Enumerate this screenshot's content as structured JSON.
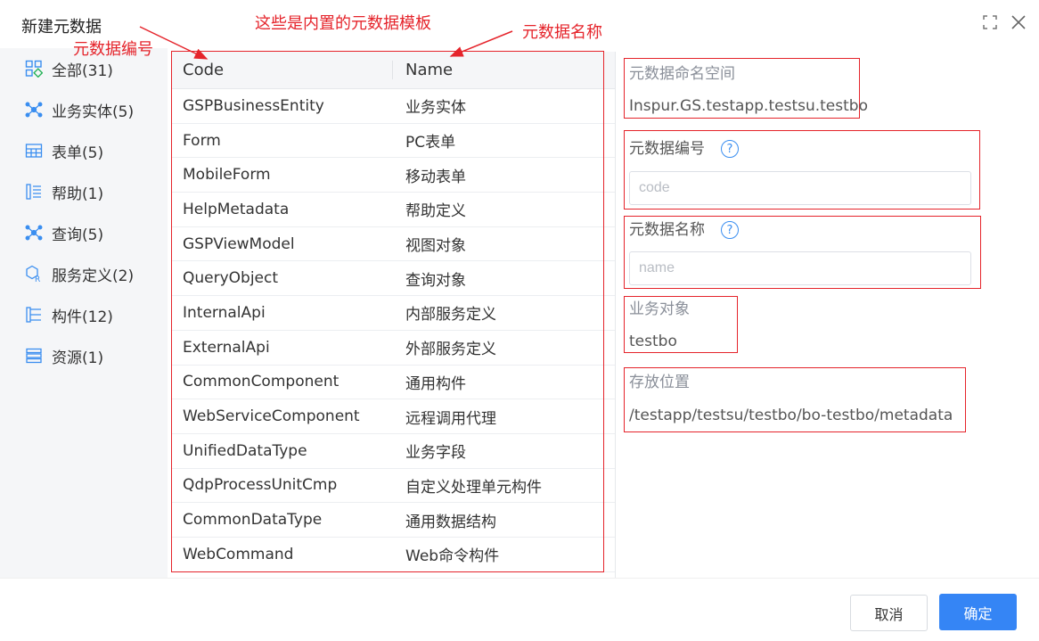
{
  "dialog": {
    "title": "新建元数据"
  },
  "annotations": {
    "builtin_templates": "这些是内置的元数据模板",
    "metadata_code": "元数据编号",
    "metadata_name": "元数据名称"
  },
  "sidebar": {
    "items": [
      {
        "label": "全部(31)",
        "icon": "grid-icon"
      },
      {
        "label": "业务实体(5)",
        "icon": "entity-icon"
      },
      {
        "label": "表单(5)",
        "icon": "table-icon"
      },
      {
        "label": "帮助(1)",
        "icon": "help-list-icon"
      },
      {
        "label": "查询(5)",
        "icon": "query-icon"
      },
      {
        "label": "服务定义(2)",
        "icon": "service-icon"
      },
      {
        "label": "构件(12)",
        "icon": "component-icon"
      },
      {
        "label": "资源(1)",
        "icon": "resource-icon"
      }
    ]
  },
  "table": {
    "headers": {
      "code": "Code",
      "name": "Name"
    },
    "rows": [
      {
        "code": "GSPBusinessEntity",
        "name": "业务实体"
      },
      {
        "code": "Form",
        "name": "PC表单"
      },
      {
        "code": "MobileForm",
        "name": "移动表单"
      },
      {
        "code": "HelpMetadata",
        "name": "帮助定义"
      },
      {
        "code": "GSPViewModel",
        "name": "视图对象"
      },
      {
        "code": "QueryObject",
        "name": "查询对象"
      },
      {
        "code": "InternalApi",
        "name": "内部服务定义"
      },
      {
        "code": "ExternalApi",
        "name": "外部服务定义"
      },
      {
        "code": "CommonComponent",
        "name": "通用构件"
      },
      {
        "code": "WebServiceComponent",
        "name": "远程调用代理"
      },
      {
        "code": "UnifiedDataType",
        "name": "业务字段"
      },
      {
        "code": "QdpProcessUnitCmp",
        "name": "自定义处理单元构件"
      },
      {
        "code": "CommonDataType",
        "name": "通用数据结构"
      },
      {
        "code": "WebCommand",
        "name": "Web命令构件"
      }
    ]
  },
  "form": {
    "namespace_label": "元数据命名空间",
    "namespace_value": "Inspur.GS.testapp.testsu.testbo",
    "code_label": "元数据编号",
    "code_placeholder": "code",
    "name_label": "元数据名称",
    "name_placeholder": "name",
    "bizobj_label": "业务对象",
    "bizobj_value": "testbo",
    "location_label": "存放位置",
    "location_value": "/testapp/testsu/testbo/bo-testbo/metadata"
  },
  "buttons": {
    "cancel": "取消",
    "ok": "确定"
  },
  "colors": {
    "accent": "#3585f5",
    "annotation": "#e5242b",
    "icon": "#3a8ef0"
  }
}
